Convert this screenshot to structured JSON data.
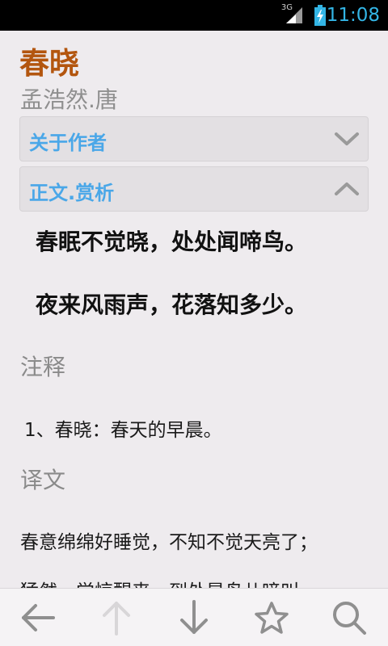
{
  "status_bar": {
    "network": "3G",
    "time": "11:08"
  },
  "poem": {
    "title": "春晓",
    "author": "孟浩然.唐",
    "lines": [
      "春眠不觉晓，处处闻啼鸟。",
      "夜来风雨声，花落知多少。"
    ]
  },
  "panels": {
    "about_author": "关于作者",
    "text_analysis": "正文.赏析"
  },
  "notes": {
    "heading": "注释",
    "items": [
      "1、春晓：春天的早晨。"
    ]
  },
  "translation": {
    "heading": "译文",
    "lines": [
      "春意绵绵好睡觉，不知不觉天亮了；",
      "猛然一觉惊醒来，到处是鸟儿啼叫"
    ]
  },
  "bottom_bar": {
    "icons": [
      "back-arrow-icon",
      "up-arrow-icon",
      "down-arrow-icon",
      "star-icon",
      "search-icon"
    ]
  },
  "colors": {
    "accent_blue": "#33b5e5",
    "title_brown": "#b3560f",
    "panel_label_blue": "#4aa7e8"
  }
}
